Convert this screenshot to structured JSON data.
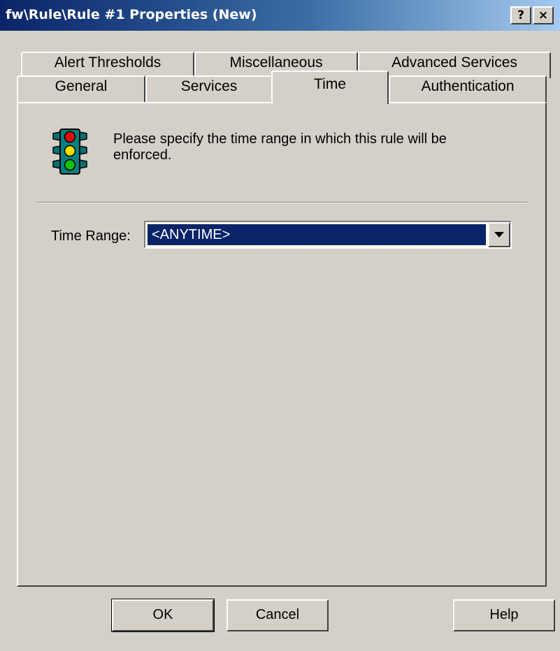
{
  "window": {
    "title": "fw\\Rule\\Rule #1 Properties (New)",
    "help_button": "?",
    "close_button": "×"
  },
  "tabs": {
    "row1": [
      "Alert Thresholds",
      "Miscellaneous",
      "Advanced Services"
    ],
    "row2": [
      "General",
      "Services",
      "Time",
      "Authentication"
    ],
    "active": "Time"
  },
  "time_page": {
    "icon": "traffic-light-icon",
    "description": "Please specify the time range in which this rule will be enforced.",
    "range_label": "Time Range:",
    "range_value": "<ANYTIME>"
  },
  "buttons": {
    "ok": "OK",
    "cancel": "Cancel",
    "help": "Help"
  },
  "colors": {
    "title_bar": "#0a246a",
    "face": "#d4d0c8",
    "selection": "#0a246a"
  }
}
